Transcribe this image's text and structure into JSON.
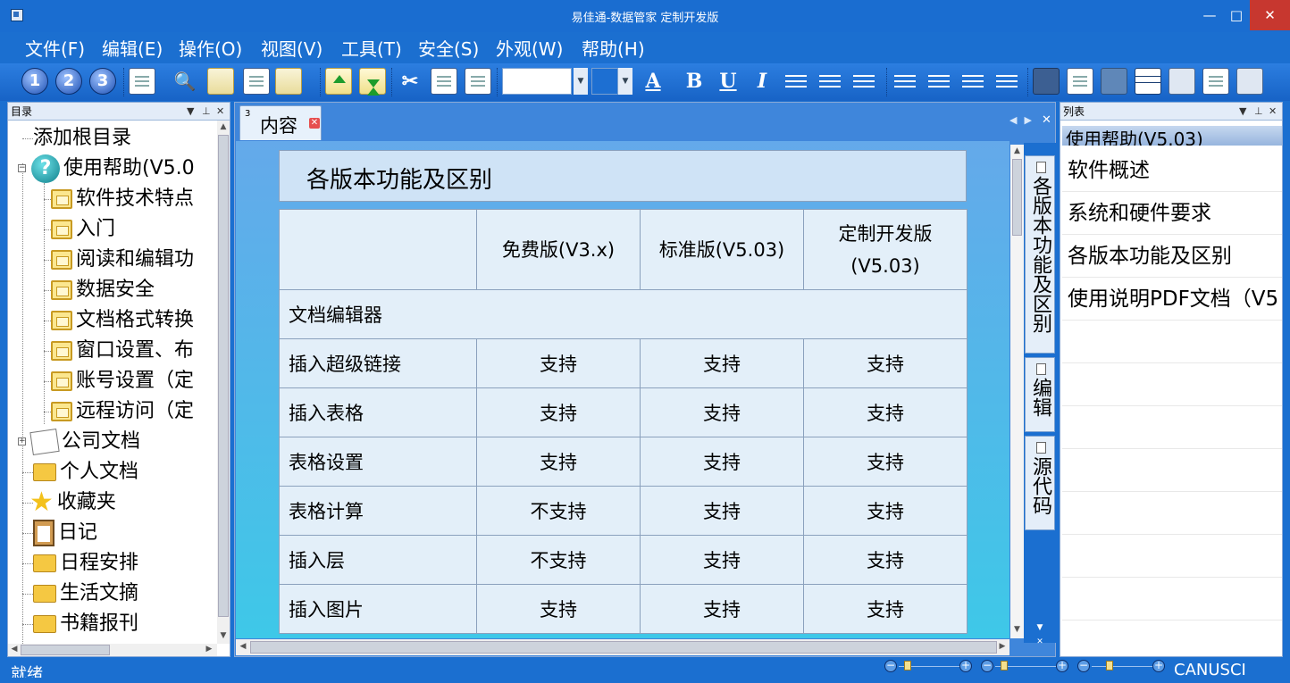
{
  "window": {
    "title": "易佳通-数据管家 定制开发版",
    "minimize": "—",
    "maximize": "□",
    "close": "✕"
  },
  "menu": [
    "文件(F)",
    "编辑(E)",
    "操作(O)",
    "视图(V)",
    "工具(T)",
    "安全(S)",
    "外观(W)",
    "帮助(H)"
  ],
  "toolbar": {
    "level1": "1",
    "level2": "2",
    "level3": "3",
    "bold": "B",
    "underline": "U",
    "italic": "I",
    "font_color": "A"
  },
  "left_pane": {
    "title": "目录",
    "tree": [
      {
        "label": "添加根目录",
        "icon": "none"
      },
      {
        "label": "使用帮助(V5.0",
        "icon": "help-icon"
      },
      {
        "label": "软件技术特点",
        "icon": "folder-doc-icon"
      },
      {
        "label": "入门",
        "icon": "folder-doc-icon"
      },
      {
        "label": "阅读和编辑功",
        "icon": "folder-doc-icon"
      },
      {
        "label": "数据安全",
        "icon": "folder-doc-icon"
      },
      {
        "label": "文档格式转换",
        "icon": "folder-doc-icon"
      },
      {
        "label": "窗口设置、布",
        "icon": "folder-doc-icon"
      },
      {
        "label": "账号设置（定",
        "icon": "folder-doc-icon"
      },
      {
        "label": "远程访问（定",
        "icon": "folder-doc-icon"
      },
      {
        "label": "公司文档",
        "icon": "notes-icon"
      },
      {
        "label": "个人文档",
        "icon": "folder-icon"
      },
      {
        "label": "收藏夹",
        "icon": "star-icon"
      },
      {
        "label": "日记",
        "icon": "clipboard-icon"
      },
      {
        "label": "日程安排",
        "icon": "folder-icon"
      },
      {
        "label": "生活文摘",
        "icon": "folder-icon"
      },
      {
        "label": "书籍报刊",
        "icon": "folder-icon"
      }
    ]
  },
  "content": {
    "tab_label": "内容",
    "tab_number": "3",
    "doc_title": "各版本功能及区别",
    "table": {
      "headers": [
        "",
        "免费版(V3.x)",
        "标准版(V5.03)",
        "定制开发版(V5.03)"
      ],
      "section": "文档编辑器",
      "rows": [
        [
          "插入超级链接",
          "支持",
          "支持",
          "支持"
        ],
        [
          "插入表格",
          "支持",
          "支持",
          "支持"
        ],
        [
          "表格设置",
          "支持",
          "支持",
          "支持"
        ],
        [
          "表格计算",
          "不支持",
          "支持",
          "支持"
        ],
        [
          "插入层",
          "不支持",
          "支持",
          "支持"
        ],
        [
          "插入图片",
          "支持",
          "支持",
          "支持"
        ]
      ]
    },
    "side_tabs": [
      "各版本功能及区别",
      "编辑",
      "源代码"
    ]
  },
  "right_pane": {
    "title": "列表",
    "group": "使用帮助(V5.03)",
    "items": [
      "软件概述",
      "系统和硬件要求",
      "各版本功能及区别",
      "使用说明PDF文档（V5"
    ]
  },
  "status": {
    "left": "就绪",
    "right": "CANUSCI"
  },
  "colors": {
    "accent": "#1b6fd0",
    "table_cell": "#e3eff9",
    "close_red": "#c7372f"
  }
}
